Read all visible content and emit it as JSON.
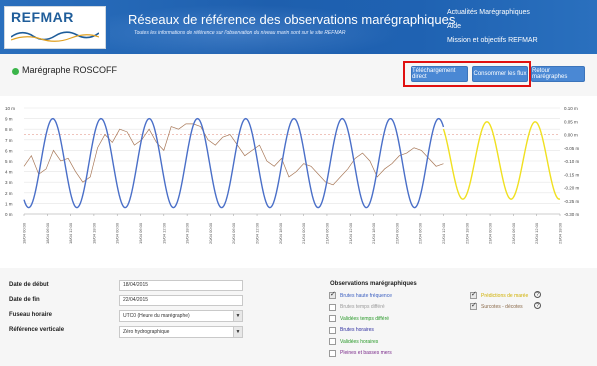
{
  "header": {
    "logo_text": "REFMAR",
    "title": "Réseaux de référence des observations marégraphiques",
    "subtitle": "Toutes les informations de référence sur l'observation du niveau marin sont sur le site REFMAR",
    "nav": [
      "Actualités Marégraphiques",
      "Aide",
      "Mission et objectifs REFMAR"
    ]
  },
  "station": {
    "title": "Marégraphe ROSCOFF",
    "buttons": {
      "download": "Téléchargement direct",
      "flux": "Consommer les flux",
      "back": "Retour marégraphes"
    }
  },
  "chart_data": {
    "type": "line",
    "y_left_ticks": [
      "10 m",
      "9 m",
      "8 m",
      "7 m",
      "6 m",
      "5 m",
      "4 m",
      "3 m",
      "2 m",
      "1 m",
      "0 m"
    ],
    "y_left_range": [
      0,
      10
    ],
    "y_right_ticks": [
      "0.10 m",
      "0.05 m",
      "0.00 m",
      "-0.05 m",
      "-0.10 m",
      "-0.15 m",
      "-0.20 m",
      "-0.25 m",
      "-0.30 m"
    ],
    "y_right_range": [
      -0.3,
      0.1
    ],
    "x_ticks": [
      "18/04 00:00",
      "18/04 06:00",
      "18/04 12:00",
      "18/04 18:00",
      "19/04 00:00",
      "19/04 06:00",
      "19/04 12:00",
      "19/04 18:00",
      "20/04 00:00",
      "20/04 06:00",
      "20/04 12:00",
      "20/04 18:00",
      "21/04 00:00",
      "21/04 06:00",
      "21/04 12:00",
      "21/04 18:00",
      "22/04 00:00",
      "22/04 06:00",
      "22/04 12:00",
      "22/04 18:00",
      "23/04 00:00",
      "23/04 06:00",
      "23/04 12:00",
      "23/04 18:00"
    ],
    "series": [
      {
        "color": "#4a6fc8",
        "axis": "left",
        "period_h": 12.42,
        "high": 9.0,
        "low": 0.6,
        "hours": [
          0,
          108
        ]
      },
      {
        "color": "#f0e020",
        "axis": "left",
        "period_h": 12.42,
        "high": 8.7,
        "low": 1.4,
        "hours": [
          108,
          138
        ]
      },
      {
        "color": "#a87858",
        "axis": "right",
        "values": [
          -0.12,
          -0.08,
          -0.15,
          -0.13,
          -0.06,
          -0.1,
          -0.09,
          -0.14,
          -0.18,
          -0.16,
          -0.05,
          0.0,
          -0.03,
          0.02,
          0.01,
          -0.04,
          -0.02,
          0.02,
          -0.03,
          -0.06,
          0.03,
          0.02,
          0.04,
          0.04,
          0.03,
          -0.02,
          -0.04,
          -0.01,
          0.0,
          -0.04,
          -0.08,
          -0.06,
          -0.04,
          -0.1,
          -0.12,
          -0.09,
          -0.16,
          -0.14,
          -0.11,
          -0.12,
          -0.15,
          -0.18,
          -0.19,
          -0.16,
          -0.13,
          -0.09,
          -0.07,
          -0.1,
          -0.16,
          -0.13,
          -0.11,
          -0.08,
          -0.07,
          -0.05,
          -0.06,
          -0.09,
          -0.12,
          -0.11
        ],
        "hours": [
          0,
          108
        ]
      }
    ]
  },
  "form": {
    "start_label": "Date de début",
    "start_value": "18/04/2015",
    "end_label": "Date de fin",
    "end_value": "22/04/2015",
    "tz_label": "Fuseau horaire",
    "tz_value": "UTC0 (Heure du marégraphe)",
    "ref_label": "Référence verticale",
    "ref_value": "Zéro hydrographique",
    "obs_title": "Observations marégraphiques",
    "checkboxes": [
      {
        "label": "Brutes haute fréquence",
        "checked": true,
        "color": "#3b5fc0"
      },
      {
        "label": "Brutes temps différé",
        "checked": false,
        "color": "#9a9a9a"
      },
      {
        "label": "Validées temps différé",
        "checked": false,
        "color": "#2a9a2a"
      },
      {
        "label": "Brutes horaires",
        "checked": false,
        "color": "#3030a0"
      },
      {
        "label": "Validées horaires",
        "checked": false,
        "color": "#2a9a2a"
      },
      {
        "label": "Pleines et basses mers",
        "checked": false,
        "color": "#7a2a8a"
      }
    ],
    "right_checkboxes": [
      {
        "label": "Prédictions de marée",
        "checked": true,
        "color": "#d0b000"
      },
      {
        "label": "Surcotes - décotes",
        "checked": true,
        "color": "#8a6a4a"
      }
    ],
    "help_glyph": "?"
  }
}
